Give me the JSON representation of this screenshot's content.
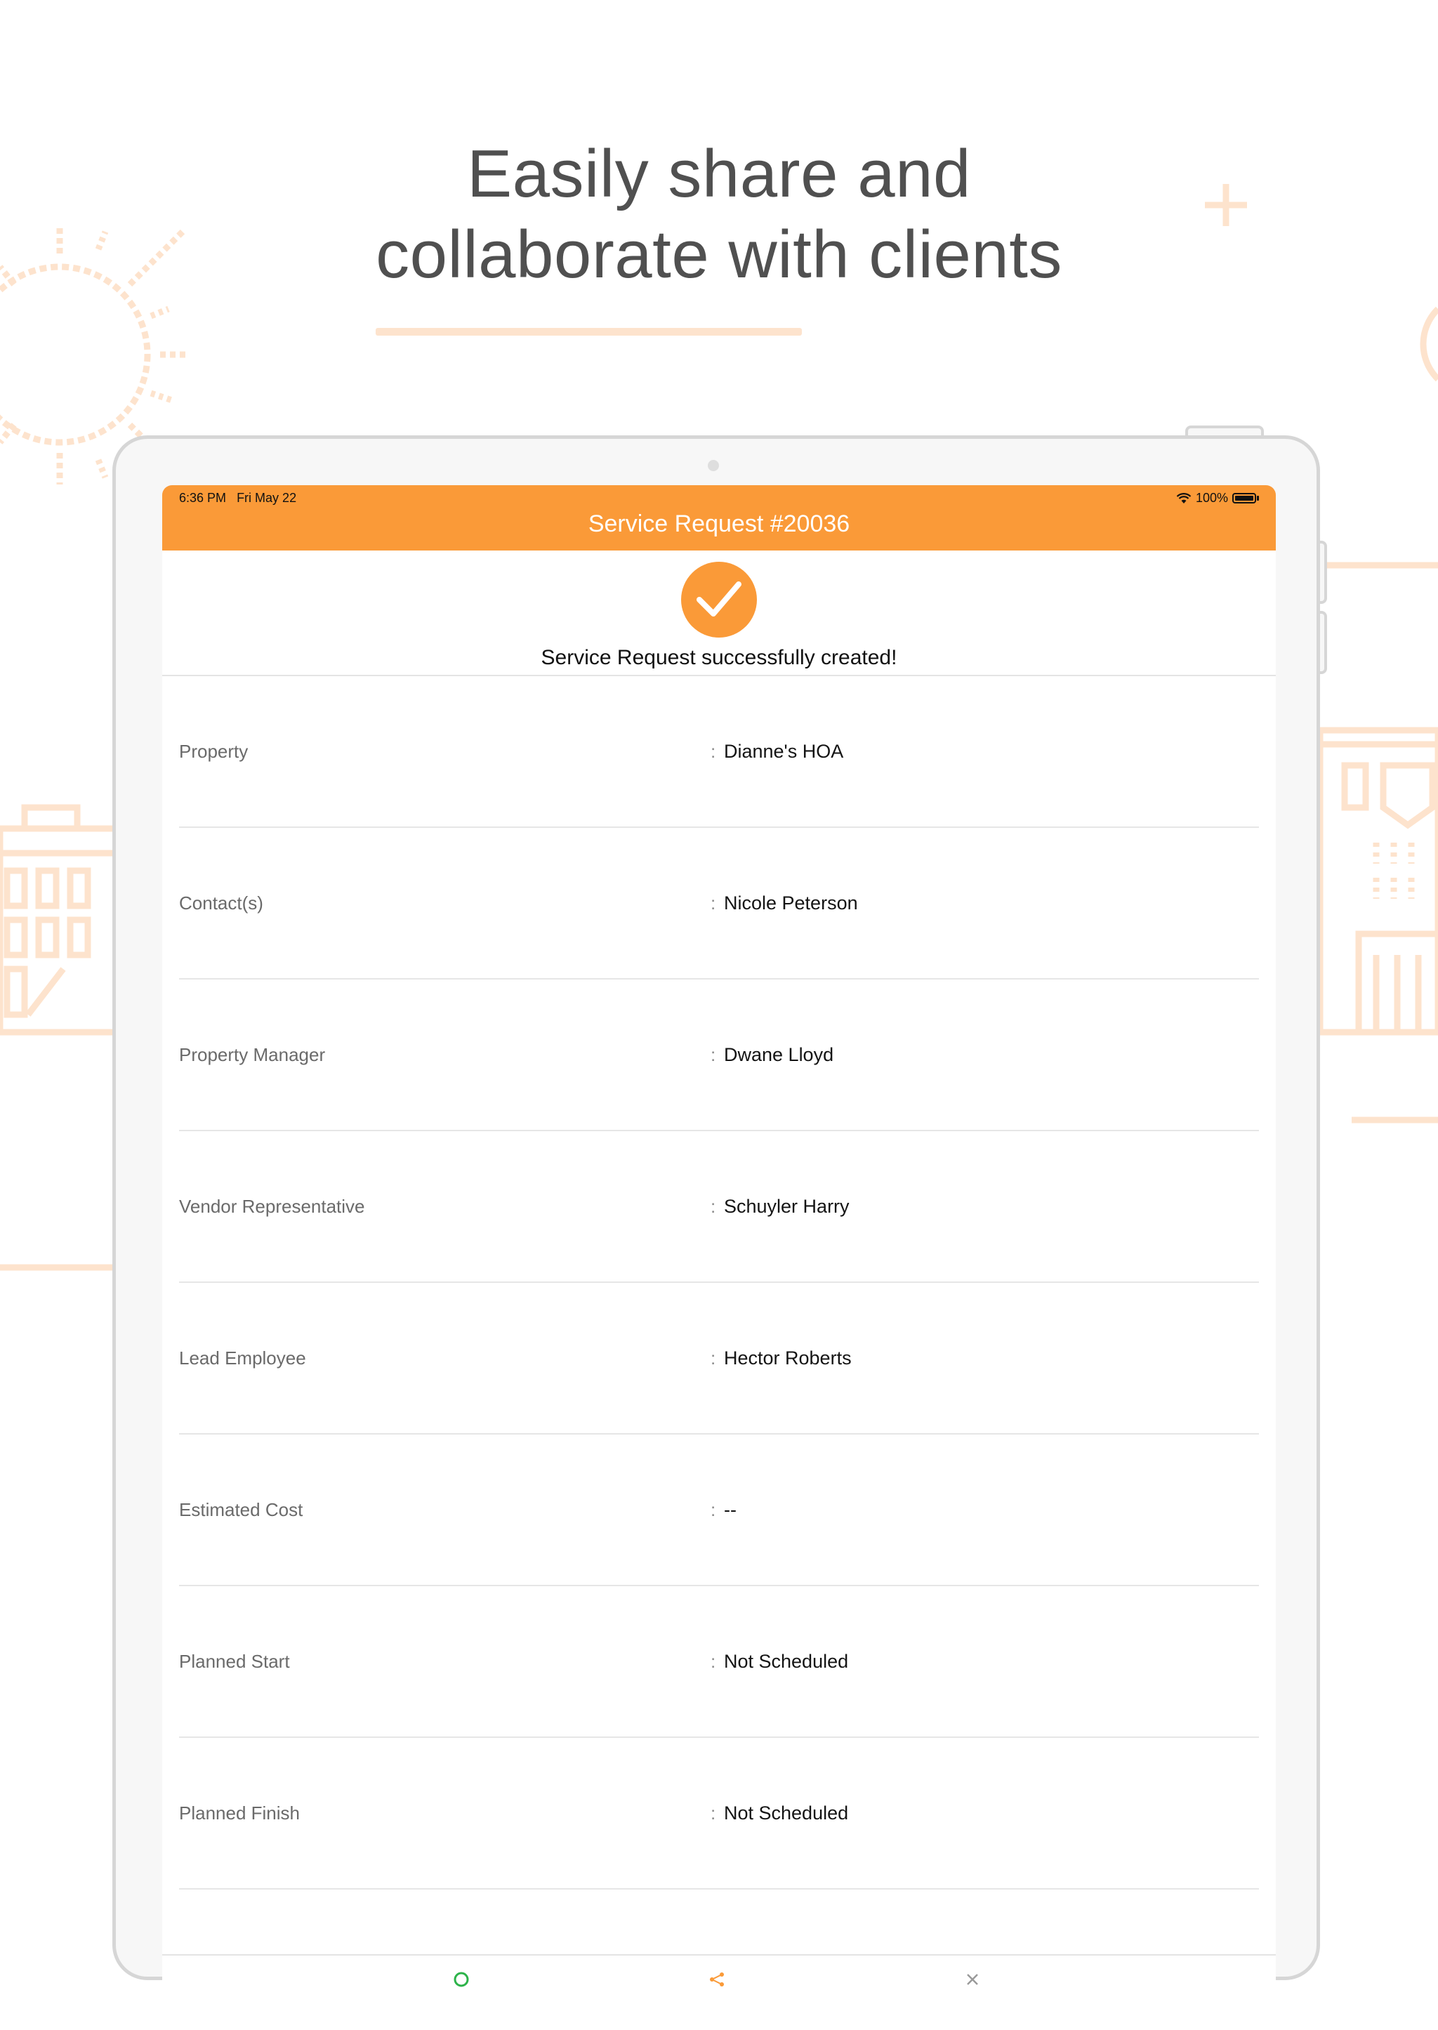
{
  "headline": {
    "line1": "Easily share and",
    "line2": "collaborate with clients"
  },
  "status_bar": {
    "time": "6:36 PM",
    "date": "Fri May 22",
    "battery": "100%"
  },
  "nav": {
    "title": "Service Request #20036"
  },
  "success": {
    "message": "Service Request successfully created!"
  },
  "details": {
    "separator": ":",
    "rows": [
      {
        "label": "Property",
        "value": "Dianne's HOA"
      },
      {
        "label": "Contact(s)",
        "value": "Nicole Peterson"
      },
      {
        "label": "Property Manager",
        "value": "Dwane Lloyd"
      },
      {
        "label": "Vendor Representative",
        "value": "Schuyler Harry"
      },
      {
        "label": "Lead Employee",
        "value": "Hector Roberts"
      },
      {
        "label": "Estimated Cost",
        "value": "--"
      },
      {
        "label": "Planned Start",
        "value": "Not Scheduled"
      },
      {
        "label": "Planned Finish",
        "value": "Not Scheduled"
      }
    ]
  },
  "colors": {
    "accent": "#fa9a38",
    "decoration": "#fde3cd",
    "headline": "#505050"
  },
  "icons": {
    "tab_left": "circle-icon",
    "tab_center": "share-icon",
    "tab_right": "close-icon"
  }
}
